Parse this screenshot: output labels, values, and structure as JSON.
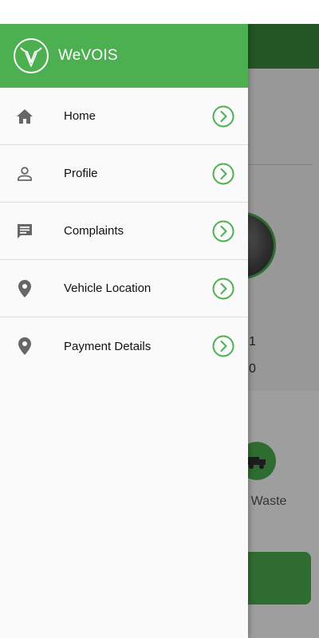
{
  "app": {
    "name": "WeVOIS"
  },
  "drawer": {
    "items": [
      {
        "label": "Home",
        "icon": "home-icon"
      },
      {
        "label": "Profile",
        "icon": "person-icon"
      },
      {
        "label": "Complaints",
        "icon": "message-icon"
      },
      {
        "label": "Vehicle Location",
        "icon": "location-pin-icon"
      },
      {
        "label": "Payment Details",
        "icon": "location-pin-icon"
      }
    ]
  },
  "background": {
    "partial_text_1": "1",
    "partial_text_2": "0",
    "waste_label": "re Waste"
  },
  "colors": {
    "brand_green": "#4caf50",
    "dark_green": "#3a8a3a"
  }
}
